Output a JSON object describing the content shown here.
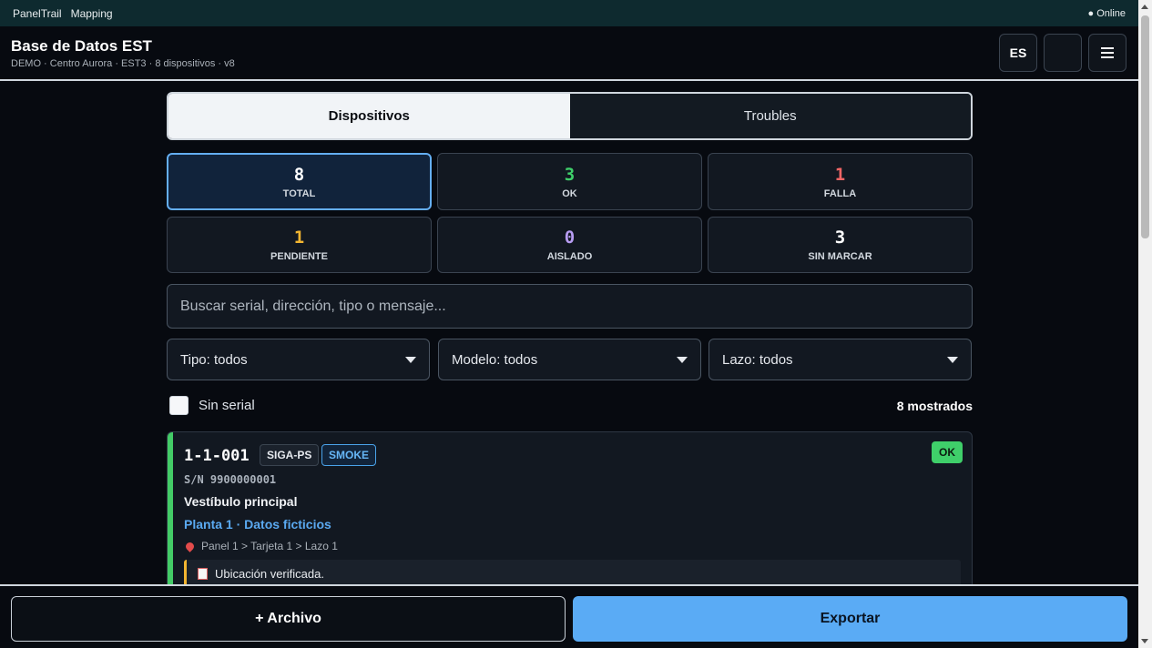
{
  "topbar": {
    "links": [
      "PanelTrail",
      "Mapping"
    ],
    "status": "● Online"
  },
  "header": {
    "title": "Base de Datos EST",
    "subtitle": "DEMO · Centro Aurora · EST3 · 8 dispositivos · v8",
    "lang_label": "ES",
    "theme_icon": "moon-icon",
    "menu_icon": "hamburger-menu-icon"
  },
  "tabs": [
    {
      "label": "Dispositivos",
      "active": true
    },
    {
      "label": "Troubles",
      "active": false
    }
  ],
  "stats": [
    {
      "value": "8",
      "label": "TOTAL",
      "color": "#ffffff",
      "active": true
    },
    {
      "value": "3",
      "label": "OK",
      "color": "#3fcf6a"
    },
    {
      "value": "1",
      "label": "FALLA",
      "color": "#f06565"
    },
    {
      "value": "1",
      "label": "PENDIENTE",
      "color": "#f2b531"
    },
    {
      "value": "0",
      "label": "AISLADO",
      "color": "#b79cf2"
    },
    {
      "value": "3",
      "label": "SIN MARCAR",
      "color": "#ffffff"
    }
  ],
  "search": {
    "placeholder": "Buscar serial, dirección, tipo o mensaje..."
  },
  "filters": {
    "tipo": "Tipo: todos",
    "modelo": "Modelo: todos",
    "lazo": "Lazo: todos"
  },
  "no_serial_label": "Sin serial",
  "shown_count": "8 mostrados",
  "device": {
    "address": "1-1-001",
    "model": "SIGA-PS",
    "type": "SMOKE",
    "status": "OK",
    "serial": "S/N 9900000001",
    "description": "Vestíbulo principal",
    "floor": "Planta 1 · Datos ficticios",
    "path": "Panel 1 > Tarjeta 1 > Lazo 1",
    "note": "Ubicación verificada.",
    "status_color": "#43cc67",
    "note_accent": "#f2b531"
  },
  "footer": {
    "archive_label": "+ Archivo",
    "export_label": "Exportar"
  },
  "colors": {
    "accent": "#5aabf5",
    "background": "#070a10",
    "topbar": "#0e2a2f"
  }
}
